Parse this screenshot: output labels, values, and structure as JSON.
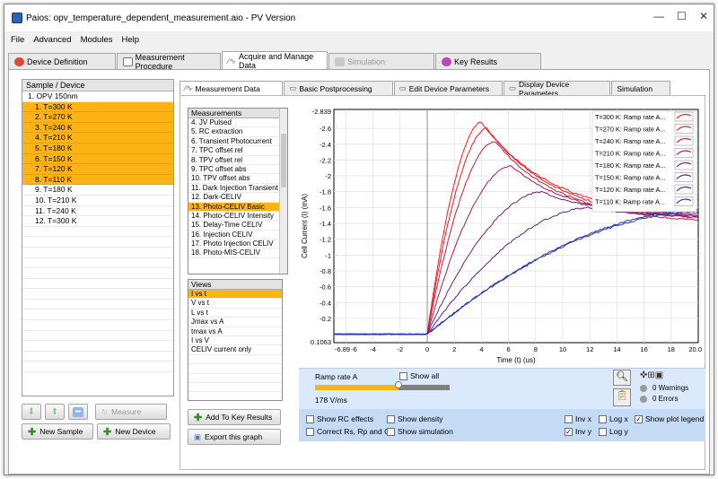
{
  "window": {
    "title": "Paios: opv_temperature_dependent_measurement.aio  -  PV Version",
    "min": "—",
    "max": "☐",
    "close": "✕"
  },
  "menu": [
    "File",
    "Advanced",
    "Modules",
    "Help"
  ],
  "top_tabs": [
    {
      "label": "Device Definition",
      "color": "#d84a3a"
    },
    {
      "label": "Measurement Procedure",
      "color": "#7a7a7a"
    },
    {
      "label": "Acquire and Manage Data",
      "color": "#e05050"
    },
    {
      "label": "Simulation",
      "color": "#b0b0b0"
    },
    {
      "label": "Key Results",
      "color": "#b84ab0"
    }
  ],
  "sample_list": {
    "header": "Sample / Device",
    "rows": [
      "1. OPV 150nm",
      "1. T=300 K",
      "2. T=270 K",
      "3. T=240 K",
      "4. T=210 K",
      "5. T=180 K",
      "6. T=150 K",
      "7. T=120 K",
      "8. T=110 K",
      "9. T=180 K",
      "10. T=210 K",
      "11. T=240 K",
      "12. T=300 K"
    ]
  },
  "buttons": {
    "measure": "Measure",
    "new_sample": "New Sample",
    "new_device": "New Device",
    "add_key": "Add To Key Results",
    "export": "Export this graph"
  },
  "inner_tabs": [
    "Measurement Data",
    "Basic Postprocessing",
    "Edit Device Parameters",
    "Display Device Parameters",
    "Simulation"
  ],
  "measurements": {
    "header": "Measurements",
    "rows": [
      "4. JV Pulsed",
      "5. RC extraction",
      "6. Transient Photocurrent",
      "7. TPC offset rel",
      "8. TPV offset rel",
      "9. TPC offset abs",
      "10. TPV offset abs",
      "11. Dark Injection Transient",
      "12. Dark-CELIV",
      "13. Photo-CELIV Basic",
      "14. Photo-CELIV Intensity",
      "15. Delay-Time CELIV",
      "16. Injection CELIV",
      "17. Photo Injection CELIV",
      "18. Photo-MIS-CELIV"
    ],
    "selected": 9
  },
  "views": {
    "header": "Views",
    "rows": [
      "I vs t",
      "V vs t",
      "L vs t",
      "Jmax vs A",
      "tmax vs A",
      "I vs V",
      "CELIV current only"
    ],
    "selected": 0
  },
  "controls": {
    "ramp_label": "Ramp rate A",
    "show_all": "Show all",
    "ramp_value": "178 V/ms",
    "ramp_fraction": 0.62,
    "warnings": "0 Warnings",
    "errors": "0 Errors",
    "show_rc": "Show RC effects",
    "correct": "Correct Rs, Rp and C",
    "show_density": "Show density",
    "show_sim": "Show simulation",
    "inv_x": "Inv x",
    "inv_y": "Inv y",
    "log_x": "Log x",
    "log_y": "Log y",
    "show_legend": "Show plot legend"
  },
  "chart_data": {
    "type": "line",
    "xlabel": "Time (t) (us)",
    "ylabel": "Cell Current (I) (mA)",
    "x_ticks": [
      "-6.89",
      "-6",
      "-4",
      "-2",
      "0",
      "2",
      "4",
      "6",
      "8",
      "10",
      "12",
      "14",
      "16",
      "18",
      "20.0"
    ],
    "y_ticks": [
      "-2.839",
      "-2.6",
      "-2.4",
      "-2.2",
      "-2",
      "-1.8",
      "-1.6",
      "-1.4",
      "-1.2",
      "-1",
      "-0.8",
      "-0.6",
      "-0.4",
      "-0.2",
      "0.1063"
    ],
    "xlim": [
      -6.89,
      20.0
    ],
    "ylim": [
      0.1063,
      -2.839
    ],
    "inverted_y": true,
    "series": [
      {
        "name": "T=300 K: Ramp rate A...",
        "color": "#ff1a1a",
        "peak_x": 4.0,
        "peak_y": -2.68,
        "end_y": -1.5
      },
      {
        "name": "T=270 K: Ramp rate A...",
        "color": "#e0202a",
        "peak_x": 4.4,
        "peak_y": -2.6,
        "end_y": -1.47
      },
      {
        "name": "T=240 K: Ramp rate A...",
        "color": "#c81e3c",
        "peak_x": 5.0,
        "peak_y": -2.44,
        "end_y": -1.44
      },
      {
        "name": "T=210 K: Ramp rate A...",
        "color": "#a01e50",
        "peak_x": 6.2,
        "peak_y": -2.13,
        "end_y": -1.48
      },
      {
        "name": "T=180 K: Ramp rate A...",
        "color": "#7a1e66",
        "peak_x": 8.5,
        "peak_y": -1.8,
        "end_y": -1.52
      },
      {
        "name": "T=150 K: Ramp rate A...",
        "color": "#5a2080",
        "peak_x": 12.0,
        "peak_y": -1.6,
        "end_y": -1.5
      },
      {
        "name": "T=120 K: Ramp rate A...",
        "color": "#3a2a9a",
        "peak_x": 20.0,
        "peak_y": -1.55,
        "end_y": -1.55
      },
      {
        "name": "T=110 K: Ramp rate A...",
        "color": "#1a3ab8",
        "peak_x": 20.0,
        "peak_y": -1.57,
        "end_y": -1.57
      }
    ],
    "baseline_y": 0.0
  }
}
